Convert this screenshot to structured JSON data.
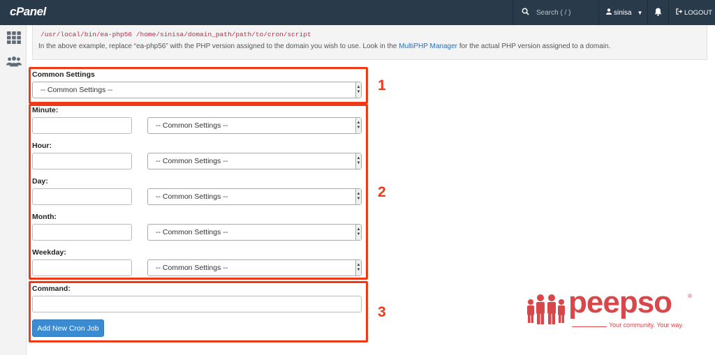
{
  "topbar": {
    "logo": "cPanel",
    "search_placeholder": "Search ( / )",
    "username": "sinisa",
    "logout_label": "LOGOUT"
  },
  "info": {
    "code_line": "/usr/local/bin/ea-php56 /home/sinisa/domain_path/path/to/cron/script",
    "note_before": "In the above example, replace “ea-php56” with the PHP version assigned to the domain you wish to use. Look in the ",
    "note_link": "MultiPHP Manager",
    "note_after": " for the actual PHP version assigned to a domain."
  },
  "form": {
    "common_settings_label": "Common Settings",
    "common_settings_value": "-- Common Settings --",
    "fields": [
      {
        "label": "Minute:",
        "select_value": "-- Common Settings --"
      },
      {
        "label": "Hour:",
        "select_value": "-- Common Settings --"
      },
      {
        "label": "Day:",
        "select_value": "-- Common Settings --"
      },
      {
        "label": "Month:",
        "select_value": "-- Common Settings --"
      },
      {
        "label": "Weekday:",
        "select_value": "-- Common Settings --"
      }
    ],
    "command_label": "Command:",
    "submit_label": "Add New Cron Job"
  },
  "annotations": {
    "box1": "1",
    "box2": "2",
    "box3": "3",
    "color": "#f03a17"
  },
  "watermark": {
    "brand": "peepso",
    "registered": "®",
    "tagline": "Your community. Your way."
  },
  "icons": {
    "search": "search-icon",
    "user": "user-icon",
    "bell": "bell-icon",
    "logout": "logout-icon",
    "grid": "grid-icon",
    "users": "users-icon"
  }
}
